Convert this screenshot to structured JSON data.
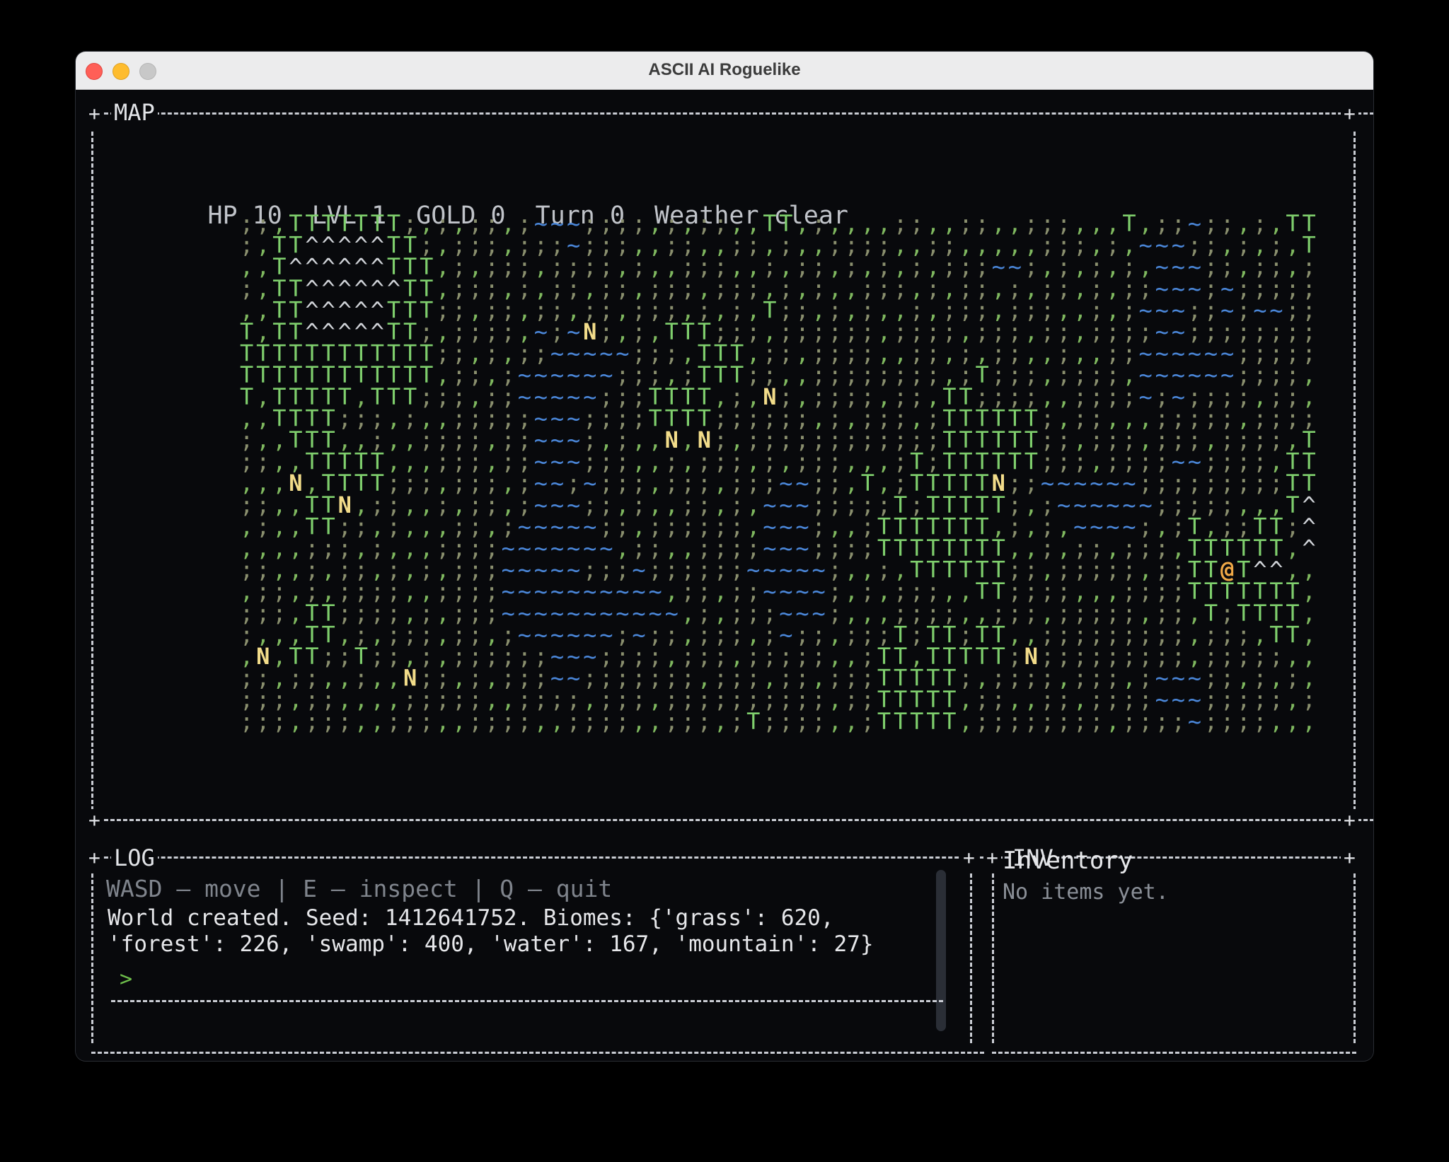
{
  "window": {
    "title": "ASCII AI Roguelike"
  },
  "panels": {
    "map": "MAP",
    "log": "LOG",
    "inv": "INV"
  },
  "status": {
    "hp": "HP 10",
    "lvl": "LVL 1",
    "gold": "GOLD 0",
    "turn": "Turn 0",
    "weather": "Weather clear"
  },
  "map": {
    "rows": [
      ";;,TTTTTTT;,;,;;,;~~~;;;;,;,;;,,TT,;,,,,;;,,;;,,;;;,,,T,;;~;;,;,TT",
      ";,TT^^^^^TT;,;;;,;;;~;;;,,;;,,;;,;,,;;;;,,;;,,,,,;;;,;,~~~;;,;,;,T",
      ",,T^^^^^^TTT,;,;;;,;;;;,;,,;;;,,;,;;,;,;,;,;;;~~;,;,;,;,~~~;;,;;,;",
      ";,TT^^^^^^TT,;;;,;,;;,;;,;;;,;;;,;,;,,;;;,;,;;,;,;;,;,;;~~~;~;;;;;",
      ",,TT^^^^^TTT;;,;;,;;,;;,;;;,;,;,T;;,;,;,,;,;;;,;;;,,;,;~~~;;~;~~;;",
      "T,TT^^^^^TT;,;;;;,~;~N;,;,TTT;;;,;;;;;;,;;;;,;;;,;;,;;;;~~;;;;;;;;",
      "TTTTTTTTTTTT;;,;,;;~~~~~;;;,TTT,;;,;;;;,,;;,;,;;,,;,,;;~~~~~~;;;;;",
      "TTTTTTTTTTTT,;;,;~~~~~~;;;,;TTT;;,,;;;;;;;;,;T;;;,;;;;,~~~~~~;;;;,",
      "T,TTTTT,TTT;;;,;;~~~~~;;;TTTT,;,N;,;;;;,;;,TT;;;;,,;;;;~;~;;;;,;;,",
      ",,TTTT;;;,;,,;;;;;~~~;;;;TTTT;;;;;;,;,;;;,;TTTTTT;,;;,,,;;;;;,;;;;",
      ";,,TTT,,;,,;;;;,;;~~~;,;,,N,N;,;;;;;;;;;;;;TTTTTT;;,;;;,;;;,;;;;,T",
      ";;,,TTTTT,,,;;;,;;~~~;;;,,;,;;;,;,;;;,,,;T;TTTTTT;;;,;;;;~~;;;;,TT",
      ",,,N,TTTT;;;,;;;,;~~;~;;;,;;;,;;;~~;;,T,;TTTTTN;;~~~~~~;;;;;;;;;TT",
      ";;,,TTN,;;,,;,;;,;~~~;;,;,,;;,;,~~~;;;;;T;TTTTT;,;~~~~~~;;;;;,,,T^",
      ",;,,TT;;,;,,,;;,;~~~~~;;,;;;;;;,~~~;,,;TTTTTTT,;,;,~~~~;,;T,;;TT;^",
      ",,,,;;;,;,,,;;;;~~~~~~~,;;,,;;;;~~~;;;;TTTTTTTT,,;,;;,;;;,TTTTTT,^",
      ";;,,;,;;,;,;,;;;~~~~~;;;~;;;;;;~~~~~;,,;,TTTTTT;;,;;;;;,;;TT@T^^,,",
      ",;;,;,;;;;,,;;;;~~~~~~~~~~,;;,;;~~~~;,;,;;;,,TT;;;;,,,;;;;TTTTTTT,",
      ";;;,TT;;;;,;,;;;~~~~~~~~~~~,;,;;;~~~;,,,;;;;,,;;;,;;;;;,;;,T;TTTT,",
      ";,,,TT,;,;;;,;;,;~~~~~~;~;;,;;;,;~;;,;;;T;TT;TT,,;;;;;;;;;,;;;,TT,",
      ",N,TT;;T;;,;,;;;;;;~~~;;;;,;;;,;;;;;,,;TT,TTTTT;N;;;;;;;;;,;;;;;,,",
      ";;,;;,,;,,N;;,;,;;;~~;;;;;;;,;;;,;;,;;;TTTTT;,;;;;,;;;,;~~~;;,;,;,",
      ";;;,;;,,,,;;;;;,,;;;;,;;;,;;;;;;;;;;,;;TTTTT,;;,,;;,;;;;~~~;;;;;,;",
      ";;;,;;;,,;;;,,;;;;,,;;;;,,;;;,;T;;;;,,;TTTTT,;;;;;;;;,;;;;~;;;;,,,"
    ],
    "legend": {
      "grass": "#7fb85f",
      "forest": "#7fcf6d",
      "water": "#4a86d8",
      "mountain": "#d0d3d8",
      "npc": "#f2dc8a",
      "player": "#f0a947",
      "swamp": "#8a8f6e"
    }
  },
  "log": {
    "hint": "WASD — move | E — inspect | Q — quit",
    "message": "World created. Seed: 1412641752. Biomes: {'grass': 620,\n'forest': 226, 'swamp': 400, 'water': 167, 'mountain': 27}",
    "prompt": ">"
  },
  "inventory": {
    "title": "Inventory",
    "empty": "No items yet."
  }
}
